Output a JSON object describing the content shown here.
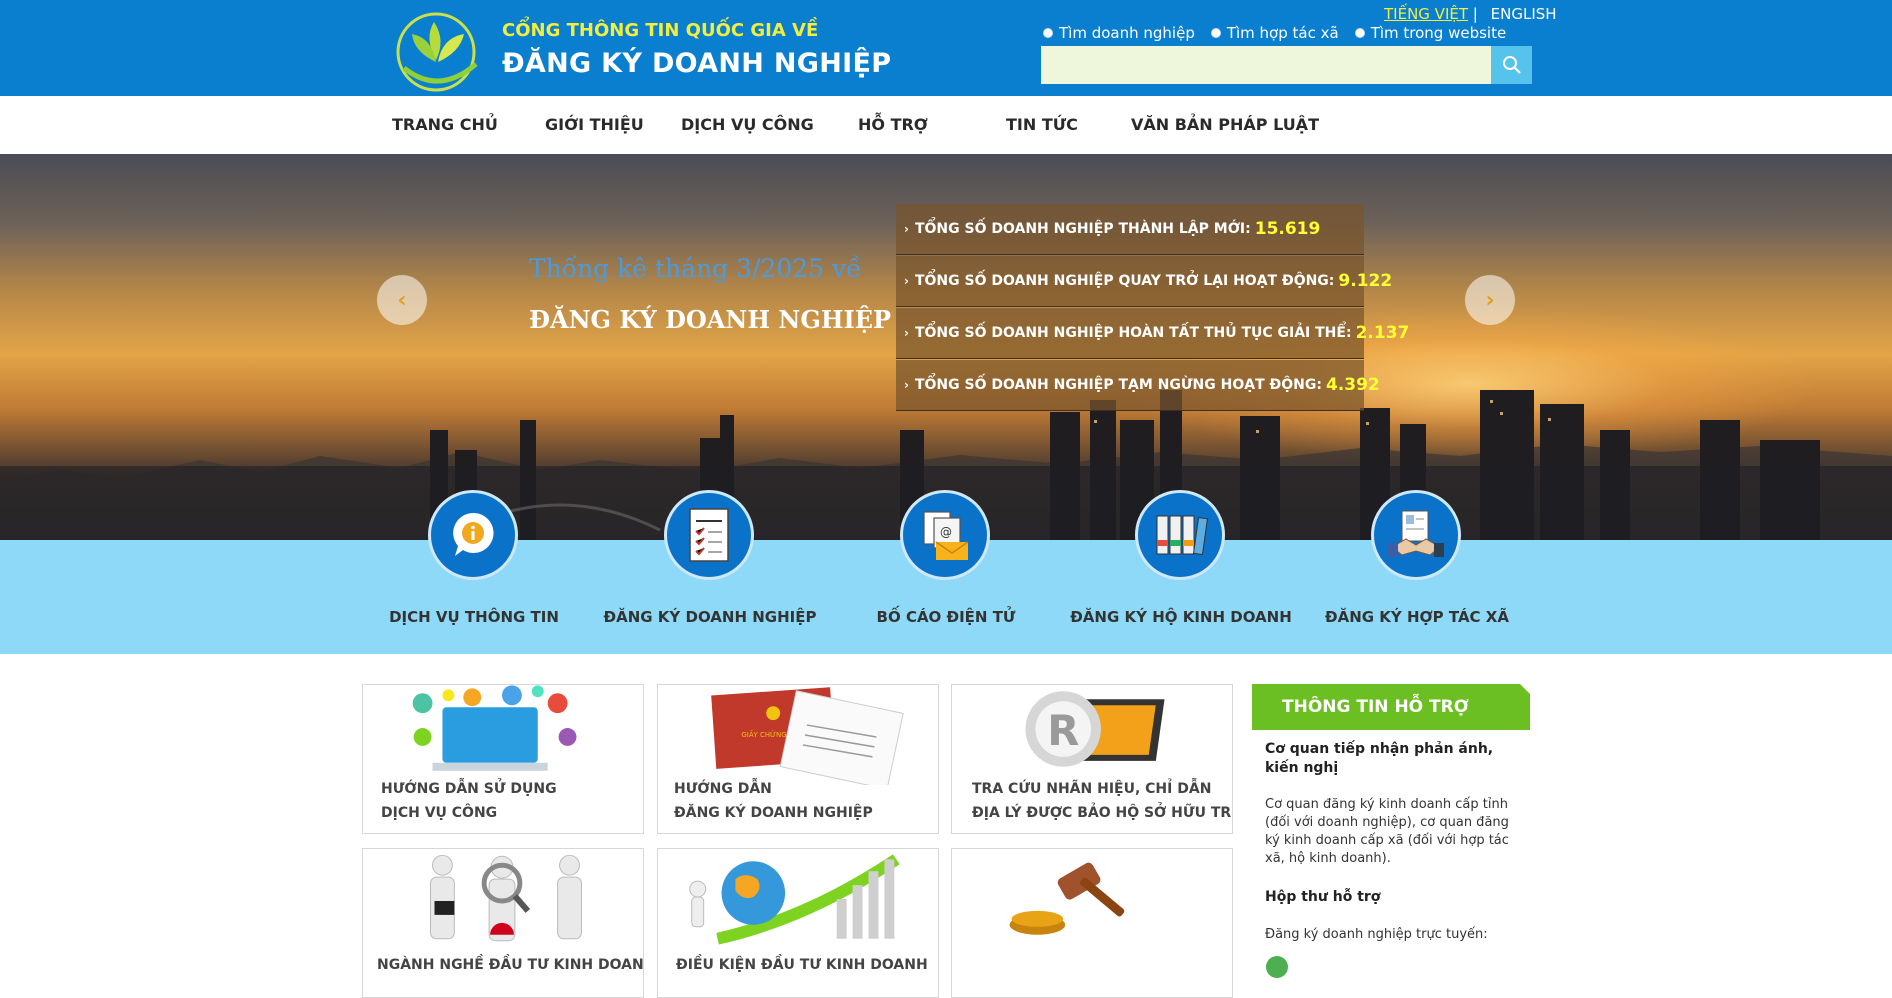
{
  "header": {
    "brand_top": "CỔNG THÔNG TIN QUỐC GIA VỀ",
    "brand_main": "ĐĂNG KÝ DOANH NGHIỆP",
    "lang_vi": "TIẾNG VIỆT",
    "lang_sep": "|",
    "lang_en": "ENGLISH",
    "search_options": [
      "Tìm doanh nghiệp",
      "Tìm hợp tác xã",
      "Tìm trong website"
    ],
    "search_value": "",
    "search_icon": "search-icon"
  },
  "nav": [
    "TRANG CHỦ",
    "GIỚI THIỆU",
    "DỊCH VỤ CÔNG",
    "HỖ TRỢ",
    "TIN TỨC",
    "VĂN BẢN PHÁP LUẬT"
  ],
  "hero": {
    "subtitle": "Thống kê tháng 3/2025 về",
    "title": "ĐĂNG KÝ DOANH NGHIỆP",
    "prev": "‹",
    "next": "›",
    "stats": [
      {
        "label": "TỔNG SỐ DOANH NGHIỆP THÀNH LẬP MỚI:",
        "value": "15.619"
      },
      {
        "label": "TỔNG SỐ DOANH NGHIỆP QUAY TRỞ LẠI HOẠT ĐỘNG:",
        "value": "9.122"
      },
      {
        "label": "TỔNG SỐ DOANH NGHIỆP HOÀN TẤT THỦ TỤC GIẢI THỂ:",
        "value": "2.137"
      },
      {
        "label": "TỔNG SỐ DOANH NGHIỆP TẠM NGỪNG HOẠT ĐỘNG:",
        "value": "4.392"
      }
    ]
  },
  "services": [
    {
      "label": "DỊCH VỤ THÔNG TIN",
      "icon": "info-icon"
    },
    {
      "label": "ĐĂNG KÝ DOANH NGHIỆP",
      "icon": "registration-form-icon"
    },
    {
      "label": "BỐ CÁO ĐIỆN TỬ",
      "icon": "email-document-icon"
    },
    {
      "label": "ĐĂNG KÝ HỘ KINH DOANH",
      "icon": "binders-icon"
    },
    {
      "label": "ĐĂNG KÝ HỢP TÁC XÃ",
      "icon": "handshake-icon"
    }
  ],
  "cards": [
    {
      "line1": "HƯỚNG DẪN SỬ DỤNG",
      "line2": "DỊCH VỤ CÔNG",
      "image": "laptop-apps-image"
    },
    {
      "line1": "HƯỚNG DẪN",
      "line2": "ĐĂNG KÝ DOANH NGHIỆP",
      "image": "certificate-image"
    },
    {
      "line1": "TRA CỨU NHÃN HIỆU, CHỈ DẪN",
      "line2": "ĐỊA LÝ ĐƯỢC BẢO HỘ SỞ HỮU TRÍ TUỆ",
      "image": "trademark-image"
    },
    {
      "line1": "NGÀNH NGHỀ ĐẦU TƯ KINH DOANH",
      "line2": "",
      "image": "business-people-image"
    },
    {
      "line1": "ĐIỀU KIỆN ĐẦU TƯ KINH DOANH",
      "line2": "",
      "image": "globe-growth-image"
    },
    {
      "line1": "",
      "line2": "",
      "image": "gavel-image"
    }
  ],
  "support": {
    "title": "THÔNG TIN HỖ TRỢ",
    "h1": "Cơ quan tiếp nhận phản ánh, kiến nghị",
    "p1": "Cơ quan đăng ký kinh doanh cấp tỉnh (đối với doanh nghiệp), cơ quan đăng ký kinh doanh cấp xã (đối với hợp tác xã, hộ kinh doanh).",
    "h2": "Hộp thư hỗ trợ",
    "p2": "Đăng ký doanh nghiệp trực tuyến:"
  },
  "colors": {
    "header_blue": "#0a7fd0",
    "brand_yellow": "#f2ee3f",
    "services_band": "#8dd9f7",
    "support_green": "#6cbf23",
    "stat_number": "#ffff33"
  }
}
